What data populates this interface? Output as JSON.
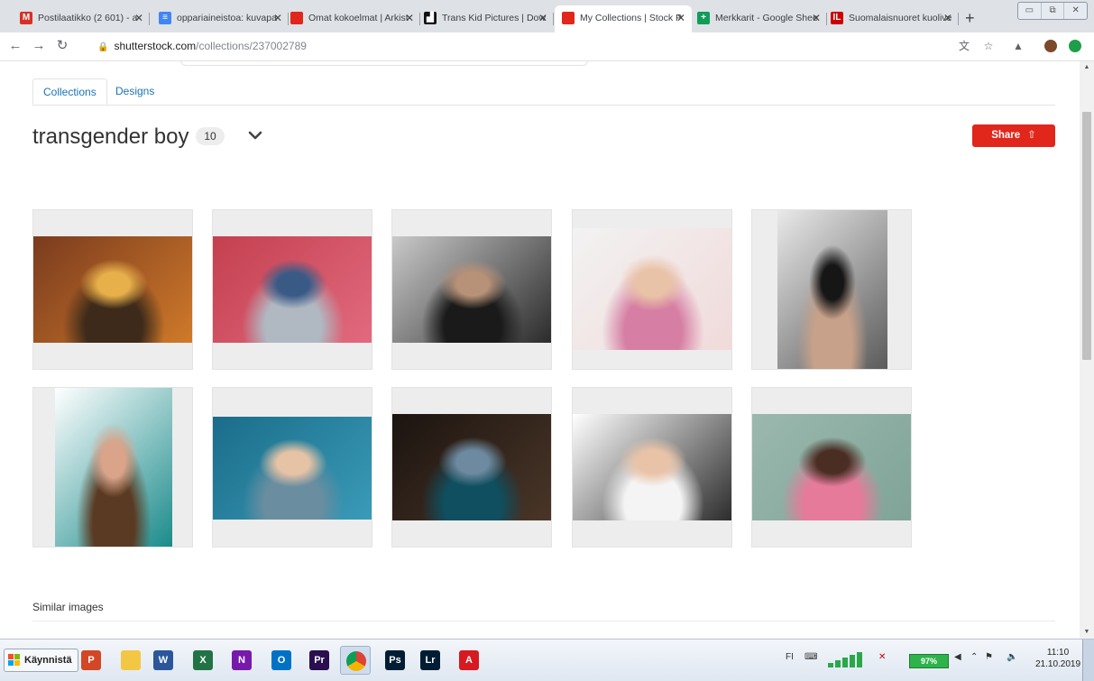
{
  "browser": {
    "tabs": [
      {
        "title": "Postilaatikko (2 601) - a",
        "fav": "M",
        "color": "#d93025",
        "active": false
      },
      {
        "title": "oppariaineistoa: kuvapa",
        "fav": "≡",
        "color": "#4285f4",
        "active": false
      },
      {
        "title": "Omat kokoelmat | Arkist",
        "fav": "",
        "color": "#e1261c",
        "active": false
      },
      {
        "title": "Trans Kid Pictures | Dow",
        "fav": "▟",
        "color": "#111111",
        "active": false
      },
      {
        "title": "My Collections | Stock P",
        "fav": "",
        "color": "#e1261c",
        "active": true
      },
      {
        "title": "Merkkarit - Google Shee",
        "fav": "+",
        "color": "#0f9d58",
        "active": false
      },
      {
        "title": "Suomalaisnuoret kuolive",
        "fav": "IL",
        "color": "#c00",
        "active": false
      }
    ],
    "new_tab": "+",
    "url_domain": "shutterstock.com",
    "url_path": "/collections/237002789"
  },
  "page": {
    "tabs": [
      "Collections",
      "Designs"
    ],
    "collection_title": "transgender boy",
    "image_count": "10",
    "share_label": "Share",
    "similar_heading": "Similar images"
  },
  "images": [
    {
      "name": "pride-parade-photo",
      "colors": [
        "#7a3b1e",
        "#d07a2a",
        "#e8b04a",
        "#3d2a1a"
      ]
    },
    {
      "name": "pink-hair-back-photo",
      "colors": [
        "#c4404f",
        "#e26a7f",
        "#3a5a86",
        "#b0b8c2"
      ]
    },
    {
      "name": "thoughtful-teen-photo",
      "colors": [
        "#c9c9c9",
        "#2a2a2a",
        "#b89278",
        "#1a1a1a"
      ]
    },
    {
      "name": "boy-rainbow-heart-photo",
      "colors": [
        "#f2f2f2",
        "#f1dada",
        "#e9c3a7",
        "#d67ea3"
      ]
    },
    {
      "name": "woman-black-skirt-photo",
      "colors": [
        "#e9e9e9",
        "#5a5a5a",
        "#161616",
        "#c7a18a"
      ]
    },
    {
      "name": "young-man-teal-shirt-photo",
      "colors": [
        "#ffffff",
        "#1a8a8a",
        "#d9a48a",
        "#5a3a22"
      ]
    },
    {
      "name": "boy-playful-hands-photo",
      "colors": [
        "#1a6d8a",
        "#3a9bb8",
        "#e7c3a6",
        "#6a8ea0"
      ]
    },
    {
      "name": "person-bowtie-window-photo",
      "colors": [
        "#1c1410",
        "#4a3628",
        "#6d8aa0",
        "#0f4f5f"
      ]
    },
    {
      "name": "boy-torn-paper-photo",
      "colors": [
        "#ffffff",
        "#2b2b2b",
        "#e9c3a7",
        "#f4f4f4"
      ]
    },
    {
      "name": "woman-sage-background-photo",
      "colors": [
        "#9bb8ae",
        "#7fa497",
        "#4a2e24",
        "#e67a9a"
      ]
    }
  ],
  "taskbar": {
    "start_label": "Käynnistä",
    "language": "FI",
    "battery": "97%",
    "time": "11:10",
    "date": "21.10.2019",
    "apps": [
      {
        "name": "powerpoint-app-icon",
        "label": "P",
        "color": "#d24726"
      },
      {
        "name": "file-explorer-app-icon",
        "label": "",
        "color": "#f2c744"
      },
      {
        "name": "word-app-icon",
        "label": "W",
        "color": "#2b579a"
      },
      {
        "name": "excel-app-icon",
        "label": "X",
        "color": "#217346"
      },
      {
        "name": "onenote-app-icon",
        "label": "N",
        "color": "#7719aa"
      },
      {
        "name": "outlook-app-icon",
        "label": "O",
        "color": "#0072c6"
      },
      {
        "name": "premiere-app-icon",
        "label": "Pr",
        "color": "#2a0e4f"
      },
      {
        "name": "chrome-app-icon",
        "label": "",
        "color": "#4285f4"
      },
      {
        "name": "photoshop-app-icon",
        "label": "Ps",
        "color": "#001d34"
      },
      {
        "name": "lightroom-app-icon",
        "label": "Lr",
        "color": "#001d34"
      },
      {
        "name": "acrobat-app-icon",
        "label": "A",
        "color": "#d71920"
      }
    ]
  }
}
